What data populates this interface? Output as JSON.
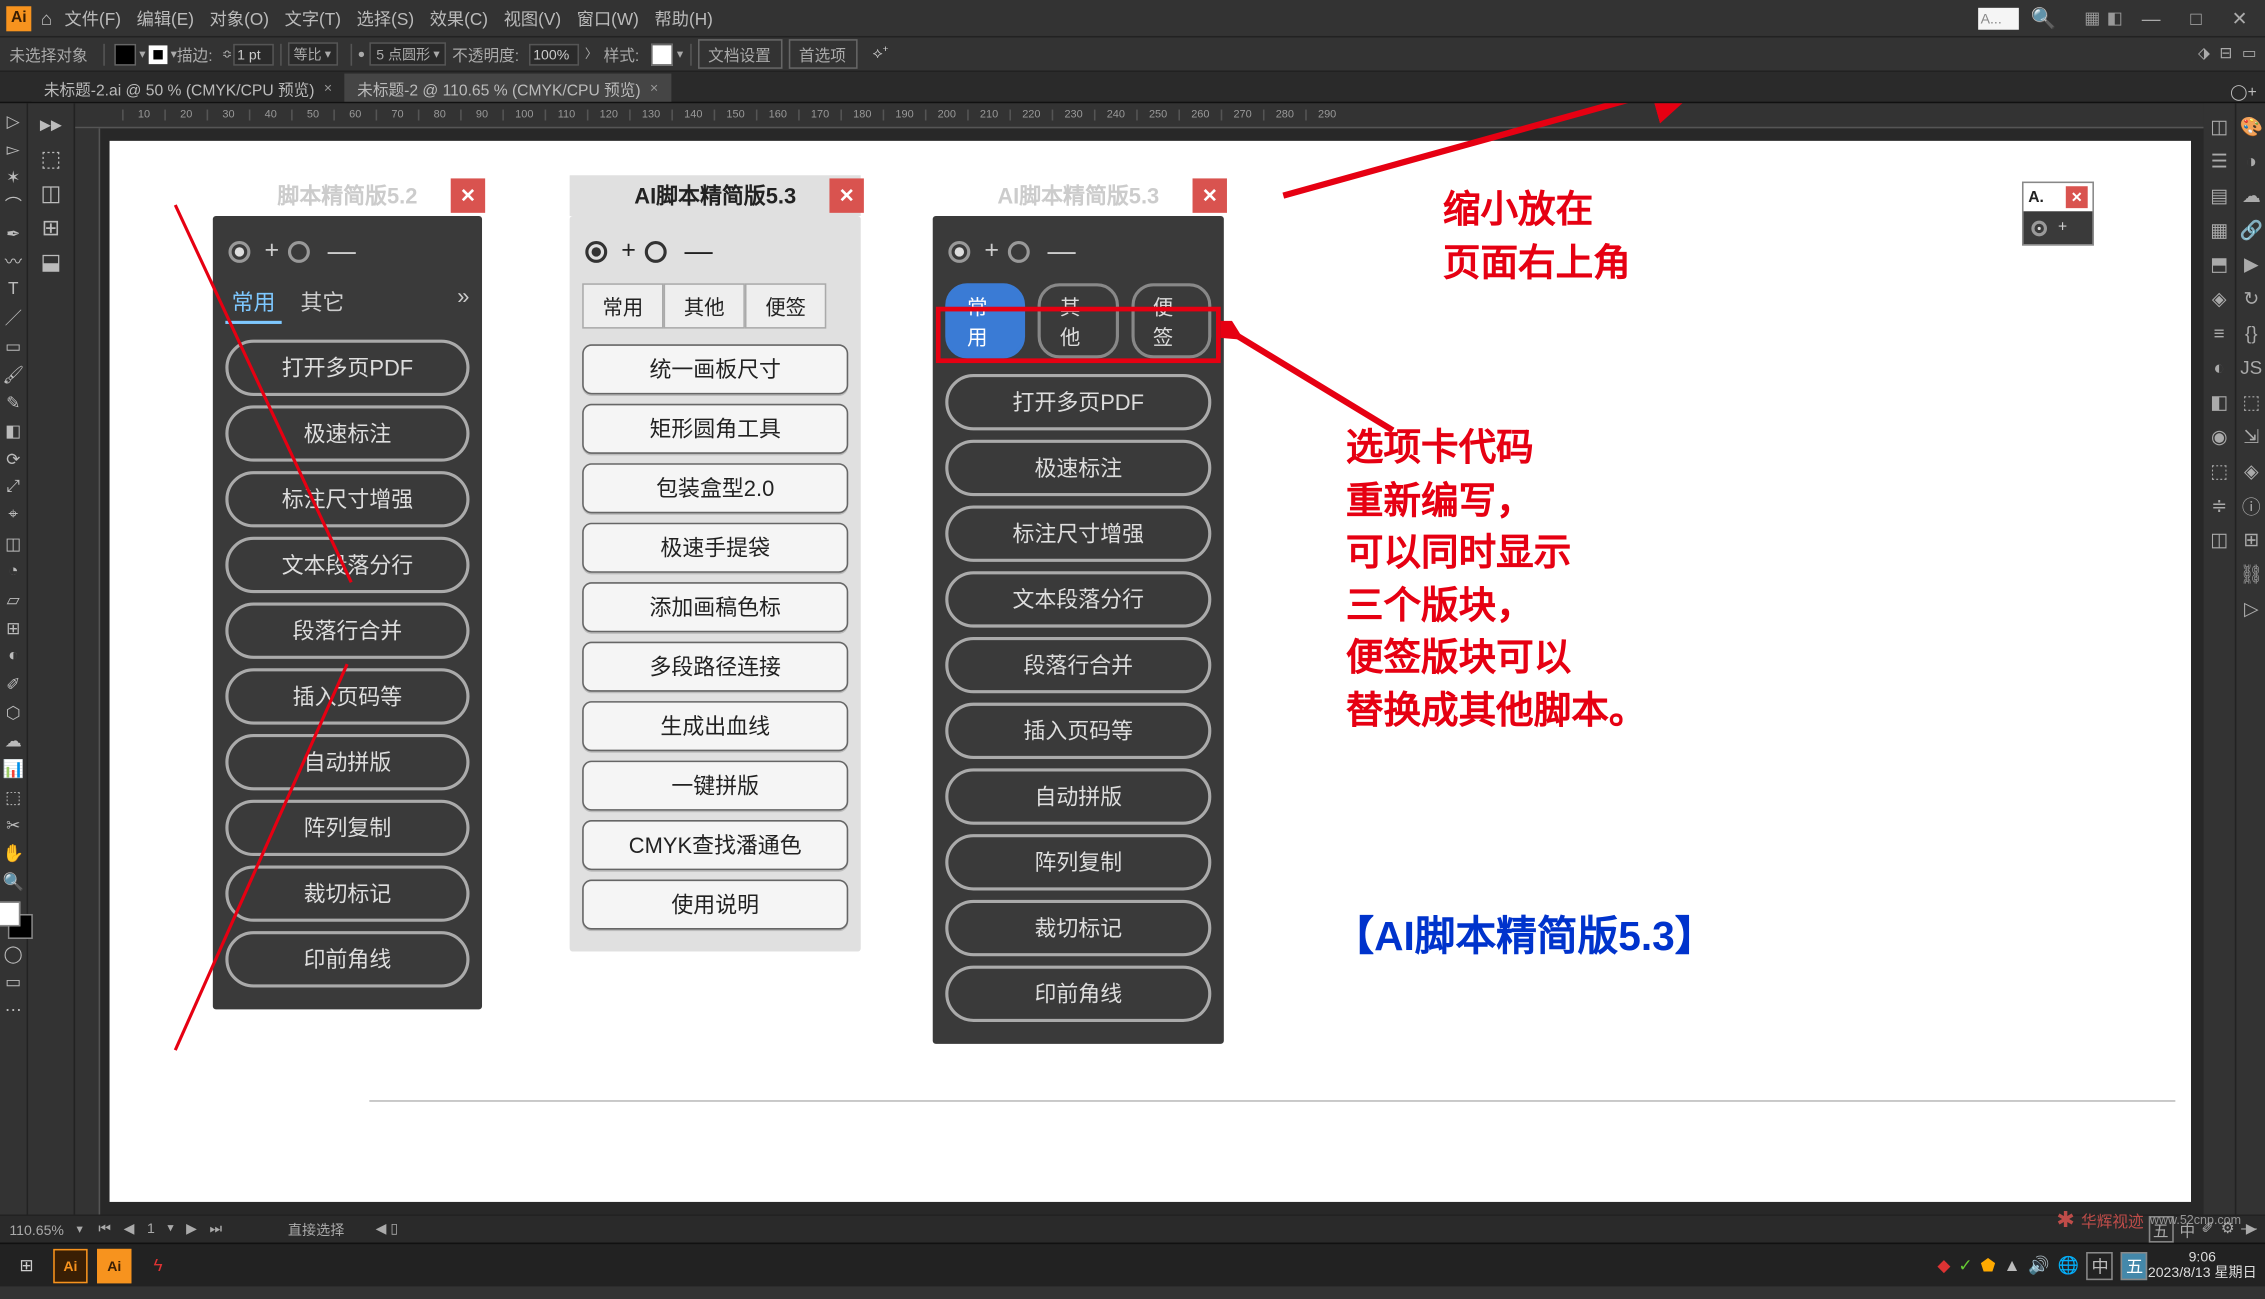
{
  "menubar": {
    "app_abbrev": "Ai",
    "items": [
      "文件(F)",
      "编辑(E)",
      "对象(O)",
      "文字(T)",
      "选择(S)",
      "效果(C)",
      "视图(V)",
      "窗口(W)",
      "帮助(H)"
    ],
    "search_hint": "A..."
  },
  "controlbar": {
    "selection": "未选择对象",
    "stroke_label": "描边:",
    "stroke_value": "1 pt",
    "uniform": "等比",
    "corner_label": "5 点圆形",
    "opacity_label": "不透明度:",
    "opacity_value": "100%",
    "style_label": "样式:",
    "doc_setup": "文档设置",
    "prefs": "首选项"
  },
  "tabs": {
    "tab1": "未标题-2.ai @ 50 % (CMYK/CPU 预览)",
    "tab2": "未标题-2 @ 110.65 % (CMYK/CPU 预览)"
  },
  "ruler_ticks": [
    10,
    20,
    30,
    40,
    50,
    60,
    70,
    80,
    90,
    100,
    110,
    120,
    130,
    140,
    150,
    160,
    170,
    180,
    190,
    200,
    210,
    220,
    230,
    240,
    250,
    260,
    270,
    280,
    290
  ],
  "panel52": {
    "title": "脚本精简版5.2",
    "tabs": [
      "常用",
      "其它"
    ],
    "buttons": [
      "打开多页PDF",
      "极速标注",
      "标注尺寸增强",
      "文本段落分行",
      "段落行合并",
      "插入页码等",
      "自动拼版",
      "阵列复制",
      "裁切标记",
      "印前角线"
    ]
  },
  "panel53_light": {
    "title": "AI脚本精简版5.3",
    "tabs": [
      "常用",
      "其他",
      "便签"
    ],
    "buttons": [
      "统一画板尺寸",
      "矩形圆角工具",
      "包装盒型2.0",
      "极速手提袋",
      "添加画稿色标",
      "多段路径连接",
      "生成出血线",
      "一键拼版",
      "CMYK查找潘通色",
      "使用说明"
    ]
  },
  "panel53_dark": {
    "title": "AI脚本精简版5.3",
    "tabs": [
      "常用",
      "其他",
      "便签"
    ],
    "buttons": [
      "打开多页PDF",
      "极速标注",
      "标注尺寸增强",
      "文本段落分行",
      "段落行合并",
      "插入页码等",
      "自动拼版",
      "阵列复制",
      "裁切标记",
      "印前角线"
    ]
  },
  "mini_panel": {
    "title": "A."
  },
  "annotations": {
    "topright1": "缩小放在",
    "topright2": "页面右上角",
    "mid1": "选项卡代码",
    "mid2": "重新编写，",
    "mid3": "可以同时显示",
    "mid4": "三个版块，",
    "mid5": "便签版块可以",
    "mid6": "替换成其他脚本。",
    "bottom": "【AI脚本精简版5.3】"
  },
  "statusbar": {
    "zoom": "110.65%",
    "page_current": "1",
    "tool": "直接选择"
  },
  "tray": {
    "ime1": "五",
    "ime_cn": "中",
    "sound": "🔊",
    "net": "🌐",
    "ime2": "中",
    "ime3": "五",
    "time": "9:06",
    "date": "2023/8/13 星期日"
  },
  "watermark": {
    "name": "华辉视迹",
    "url": "www.52cnp.com"
  }
}
